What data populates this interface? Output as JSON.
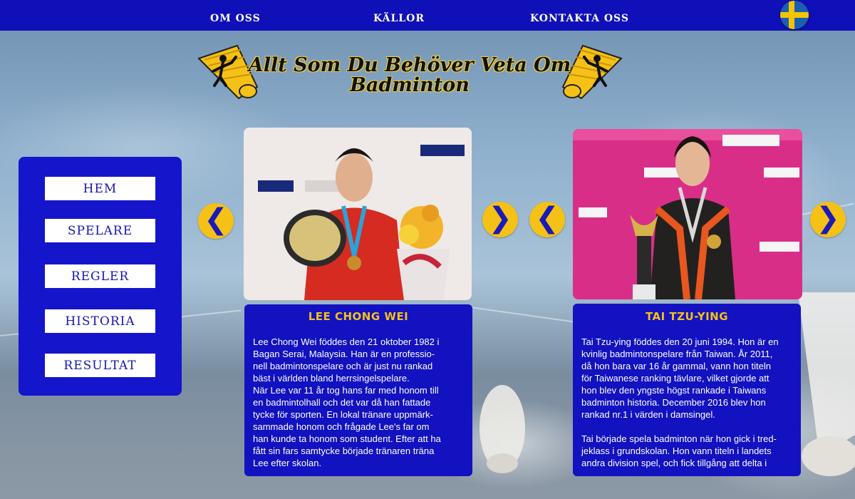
{
  "nav": {
    "items": [
      "OM OSS",
      "KÄLLOR",
      "KONTAKTA OSS"
    ],
    "language_flag": "sweden-flag"
  },
  "header": {
    "title_line1": "Allt Som Du Behöver Veta Om",
    "title_line2": "Badminton",
    "accent_color": "#f5c116"
  },
  "sidebar": {
    "items": [
      "HEM",
      "SPELARE",
      "REGLER",
      "HISTORIA",
      "RESULTAT"
    ]
  },
  "players": [
    {
      "name": "LEE CHONG WEI",
      "bio": [
        "Lee Chong Wei föddes den 21 oktober 1982 i",
        "Bagan Serai, Malaysia. Han är en professio-",
        "nell badmintonspelare och är just nu rankad",
        "bäst i världen bland herrsingelspelare.",
        "När Lee var 11 år tog hans far med honom till",
        "en badmintolhall och det var då han fattade",
        "tycke för sporten. En lokal tränare uppmärk-",
        "sammade honom och frågade Lee's far om",
        "han kunde ta honom som student. Efter att ha",
        "fått sin fars samtycke började tränaren träna",
        "Lee efter skolan."
      ]
    },
    {
      "name": "TAI TZU-YING",
      "bio": [
        "Tai Tzu-ying föddes den 20 juni 1994. Hon är en",
        "kvinlig badmintonspelare från Taiwan. År 2011,",
        "då hon bara var 16 år gammal, vann hon titeln",
        "för Taiwanese ranking tävlare, vilket gjorde att",
        "hon blev den yngste högst rankade i Taiwans",
        "badminton historia. December 2016 blev hon",
        "rankad nr.1 i värden i damsingel.",
        "",
        "Tai började spela badminton när hon gick i tred-",
        "jeklass i grundskolan. Hon vann titeln i landets",
        "andra division spel, och fick tillgång att delta i"
      ]
    }
  ],
  "arrows": {
    "prev": "❮",
    "next": "❯"
  }
}
